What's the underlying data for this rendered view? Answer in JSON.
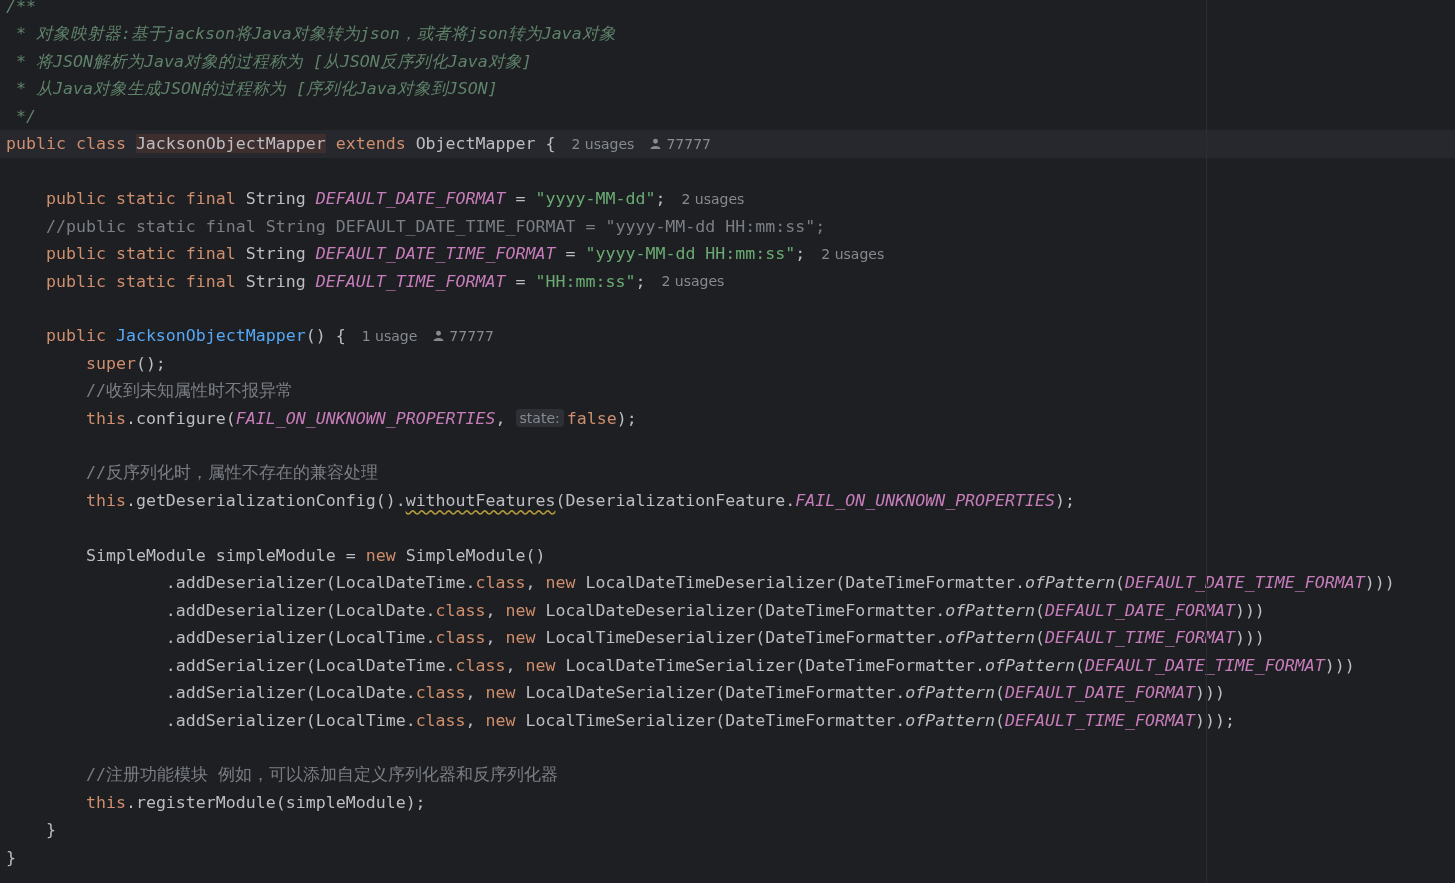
{
  "editor": {
    "lines": [
      {
        "current": false,
        "segments": [
          {
            "kind": "code",
            "tokens": [
              {
                "kind": "doc",
                "text": "/**"
              }
            ]
          }
        ]
      },
      {
        "current": false,
        "segments": [
          {
            "kind": "code",
            "tokens": [
              {
                "kind": "doc",
                "text": " * 对象映射器:基于jackson将Java对象转为json，或者将json转为Java对象"
              }
            ]
          }
        ]
      },
      {
        "current": false,
        "segments": [
          {
            "kind": "code",
            "tokens": [
              {
                "kind": "doc",
                "text": " * 将JSON解析为Java对象的过程称为 [从JSON反序列化Java对象]"
              }
            ]
          }
        ]
      },
      {
        "current": false,
        "segments": [
          {
            "kind": "code",
            "tokens": [
              {
                "kind": "doc",
                "text": " * 从Java对象生成JSON的过程称为 [序列化Java对象到JSON]"
              }
            ]
          }
        ]
      },
      {
        "current": false,
        "segments": [
          {
            "kind": "code",
            "tokens": [
              {
                "kind": "doc",
                "text": " */"
              }
            ]
          }
        ]
      },
      {
        "current": true,
        "segments": [
          {
            "kind": "code",
            "tokens": [
              {
                "kind": "keyword",
                "text": "public class "
              },
              {
                "kind": "highlight",
                "text": "JacksonObjectMapper"
              },
              {
                "kind": "keyword",
                "text": " extends "
              },
              {
                "kind": "plain",
                "text": "ObjectMapper {"
              }
            ]
          },
          {
            "kind": "usages",
            "text": "2 usages"
          },
          {
            "kind": "author",
            "text": "77777"
          }
        ]
      },
      {
        "current": false
      },
      {
        "current": false,
        "segments": [
          {
            "kind": "code",
            "tokens": [
              {
                "kind": "keyword",
                "text": "    public static final "
              },
              {
                "kind": "plain",
                "text": "String "
              },
              {
                "kind": "constant",
                "text": "DEFAULT_DATE_FORMAT"
              },
              {
                "kind": "plain",
                "text": " = "
              },
              {
                "kind": "string",
                "text": "\"yyyy-MM-dd\""
              },
              {
                "kind": "plain",
                "text": ";"
              }
            ]
          },
          {
            "kind": "usages",
            "text": "2 usages"
          }
        ]
      },
      {
        "current": false,
        "segments": [
          {
            "kind": "code",
            "tokens": [
              {
                "kind": "comment",
                "text": "    //public static final String DEFAULT_DATE_TIME_FORMAT = \"yyyy-MM-dd HH:mm:ss\";"
              }
            ]
          }
        ]
      },
      {
        "current": false,
        "segments": [
          {
            "kind": "code",
            "tokens": [
              {
                "kind": "keyword",
                "text": "    public static final "
              },
              {
                "kind": "plain",
                "text": "String "
              },
              {
                "kind": "constant",
                "text": "DEFAULT_DATE_TIME_FORMAT"
              },
              {
                "kind": "plain",
                "text": " = "
              },
              {
                "kind": "string",
                "text": "\"yyyy-MM-dd HH:mm:ss\""
              },
              {
                "kind": "plain",
                "text": ";"
              }
            ]
          },
          {
            "kind": "usages",
            "text": "2 usages"
          }
        ]
      },
      {
        "current": false,
        "segments": [
          {
            "kind": "code",
            "tokens": [
              {
                "kind": "keyword",
                "text": "    public static final "
              },
              {
                "kind": "plain",
                "text": "String "
              },
              {
                "kind": "constant",
                "text": "DEFAULT_TIME_FORMAT"
              },
              {
                "kind": "plain",
                "text": " = "
              },
              {
                "kind": "string",
                "text": "\"HH:mm:ss\""
              },
              {
                "kind": "plain",
                "text": ";"
              }
            ]
          },
          {
            "kind": "usages",
            "text": "2 usages"
          }
        ]
      },
      {
        "current": false
      },
      {
        "current": false,
        "segments": [
          {
            "kind": "code",
            "tokens": [
              {
                "kind": "keyword",
                "text": "    public "
              },
              {
                "kind": "method",
                "text": "JacksonObjectMapper"
              },
              {
                "kind": "plain",
                "text": "() {"
              }
            ]
          },
          {
            "kind": "usages",
            "text": "1 usage"
          },
          {
            "kind": "author",
            "text": "77777"
          }
        ]
      },
      {
        "current": false,
        "segments": [
          {
            "kind": "code",
            "tokens": [
              {
                "kind": "keyword",
                "text": "        super"
              },
              {
                "kind": "plain",
                "text": "();"
              }
            ]
          }
        ]
      },
      {
        "current": false,
        "segments": [
          {
            "kind": "code",
            "tokens": [
              {
                "kind": "comment",
                "text": "        //收到未知属性时不报异常"
              }
            ]
          }
        ]
      },
      {
        "current": false,
        "segments": [
          {
            "kind": "code",
            "tokens": [
              {
                "kind": "keyword",
                "text": "        this"
              },
              {
                "kind": "plain",
                "text": ".configure("
              },
              {
                "kind": "constant",
                "text": "FAIL_ON_UNKNOWN_PROPERTIES"
              },
              {
                "kind": "plain",
                "text": ","
              }
            ]
          },
          {
            "kind": "param_hint",
            "text": "state:"
          },
          {
            "kind": "code",
            "tokens": [
              {
                "kind": "keyword",
                "text": "false"
              },
              {
                "kind": "plain",
                "text": ");"
              }
            ]
          }
        ]
      },
      {
        "current": false
      },
      {
        "current": false,
        "segments": [
          {
            "kind": "code",
            "tokens": [
              {
                "kind": "comment",
                "text": "        //反序列化时，属性不存在的兼容处理"
              }
            ]
          }
        ]
      },
      {
        "current": false,
        "segments": [
          {
            "kind": "code",
            "tokens": [
              {
                "kind": "keyword",
                "text": "        this"
              },
              {
                "kind": "plain",
                "text": ".getDeserializationConfig()."
              },
              {
                "kind": "warning",
                "text": "withoutFeatures"
              },
              {
                "kind": "plain",
                "text": "(DeserializationFeature."
              },
              {
                "kind": "constant",
                "text": "FAIL_ON_UNKNOWN_PROPERTIES"
              },
              {
                "kind": "plain",
                "text": ");"
              }
            ]
          }
        ]
      },
      {
        "current": false
      },
      {
        "current": false,
        "segments": [
          {
            "kind": "code",
            "tokens": [
              {
                "kind": "plain",
                "text": "        SimpleModule simpleModule = "
              },
              {
                "kind": "keyword",
                "text": "new "
              },
              {
                "kind": "plain",
                "text": "SimpleModule()"
              }
            ]
          }
        ]
      },
      {
        "current": false,
        "segments": [
          {
            "kind": "code",
            "tokens": [
              {
                "kind": "plain",
                "text": "                .addDeserializer(LocalDateTime."
              },
              {
                "kind": "keyword",
                "text": "class"
              },
              {
                "kind": "plain",
                "text": ", "
              },
              {
                "kind": "keyword",
                "text": "new "
              },
              {
                "kind": "plain",
                "text": "LocalDateTimeDeserializer(DateTimeFormatter."
              },
              {
                "kind": "italic",
                "text": "ofPattern"
              },
              {
                "kind": "plain",
                "text": "("
              },
              {
                "kind": "constant",
                "text": "DEFAULT_DATE_TIME_FORMAT"
              },
              {
                "kind": "plain",
                "text": ")))"
              }
            ]
          }
        ]
      },
      {
        "current": false,
        "segments": [
          {
            "kind": "code",
            "tokens": [
              {
                "kind": "plain",
                "text": "                .addDeserializer(LocalDate."
              },
              {
                "kind": "keyword",
                "text": "class"
              },
              {
                "kind": "plain",
                "text": ", "
              },
              {
                "kind": "keyword",
                "text": "new "
              },
              {
                "kind": "plain",
                "text": "LocalDateDeserializer(DateTimeFormatter."
              },
              {
                "kind": "italic",
                "text": "ofPattern"
              },
              {
                "kind": "plain",
                "text": "("
              },
              {
                "kind": "constant",
                "text": "DEFAULT_DATE_FORMAT"
              },
              {
                "kind": "plain",
                "text": ")))"
              }
            ]
          }
        ]
      },
      {
        "current": false,
        "segments": [
          {
            "kind": "code",
            "tokens": [
              {
                "kind": "plain",
                "text": "                .addDeserializer(LocalTime."
              },
              {
                "kind": "keyword",
                "text": "class"
              },
              {
                "kind": "plain",
                "text": ", "
              },
              {
                "kind": "keyword",
                "text": "new "
              },
              {
                "kind": "plain",
                "text": "LocalTimeDeserializer(DateTimeFormatter."
              },
              {
                "kind": "italic",
                "text": "ofPattern"
              },
              {
                "kind": "plain",
                "text": "("
              },
              {
                "kind": "constant",
                "text": "DEFAULT_TIME_FORMAT"
              },
              {
                "kind": "plain",
                "text": ")))"
              }
            ]
          }
        ]
      },
      {
        "current": false,
        "segments": [
          {
            "kind": "code",
            "tokens": [
              {
                "kind": "plain",
                "text": "                .addSerializer(LocalDateTime."
              },
              {
                "kind": "keyword",
                "text": "class"
              },
              {
                "kind": "plain",
                "text": ", "
              },
              {
                "kind": "keyword",
                "text": "new "
              },
              {
                "kind": "plain",
                "text": "LocalDateTimeSerializer(DateTimeFormatter."
              },
              {
                "kind": "italic",
                "text": "ofPattern"
              },
              {
                "kind": "plain",
                "text": "("
              },
              {
                "kind": "constant",
                "text": "DEFAULT_DATE_TIME_FORMAT"
              },
              {
                "kind": "plain",
                "text": ")))"
              }
            ]
          }
        ]
      },
      {
        "current": false,
        "segments": [
          {
            "kind": "code",
            "tokens": [
              {
                "kind": "plain",
                "text": "                .addSerializer(LocalDate."
              },
              {
                "kind": "keyword",
                "text": "class"
              },
              {
                "kind": "plain",
                "text": ", "
              },
              {
                "kind": "keyword",
                "text": "new "
              },
              {
                "kind": "plain",
                "text": "LocalDateSerializer(DateTimeFormatter."
              },
              {
                "kind": "italic",
                "text": "ofPattern"
              },
              {
                "kind": "plain",
                "text": "("
              },
              {
                "kind": "constant",
                "text": "DEFAULT_DATE_FORMAT"
              },
              {
                "kind": "plain",
                "text": ")))"
              }
            ]
          }
        ]
      },
      {
        "current": false,
        "segments": [
          {
            "kind": "code",
            "tokens": [
              {
                "kind": "plain",
                "text": "                .addSerializer(LocalTime."
              },
              {
                "kind": "keyword",
                "text": "class"
              },
              {
                "kind": "plain",
                "text": ", "
              },
              {
                "kind": "keyword",
                "text": "new "
              },
              {
                "kind": "plain",
                "text": "LocalTimeSerializer(DateTimeFormatter."
              },
              {
                "kind": "italic",
                "text": "ofPattern"
              },
              {
                "kind": "plain",
                "text": "("
              },
              {
                "kind": "constant",
                "text": "DEFAULT_TIME_FORMAT"
              },
              {
                "kind": "plain",
                "text": ")));"
              }
            ]
          }
        ]
      },
      {
        "current": false
      },
      {
        "current": false,
        "segments": [
          {
            "kind": "code",
            "tokens": [
              {
                "kind": "comment",
                "text": "        //注册功能模块 例如，可以添加自定义序列化器和反序列化器"
              }
            ]
          }
        ]
      },
      {
        "current": false,
        "segments": [
          {
            "kind": "code",
            "tokens": [
              {
                "kind": "keyword",
                "text": "        this"
              },
              {
                "kind": "plain",
                "text": ".registerModule(simpleModule);"
              }
            ]
          }
        ]
      },
      {
        "current": false,
        "segments": [
          {
            "kind": "code",
            "tokens": [
              {
                "kind": "plain",
                "text": "    }"
              }
            ]
          }
        ]
      },
      {
        "current": false,
        "segments": [
          {
            "kind": "code",
            "tokens": [
              {
                "kind": "plain",
                "text": "}"
              }
            ]
          }
        ]
      }
    ]
  }
}
